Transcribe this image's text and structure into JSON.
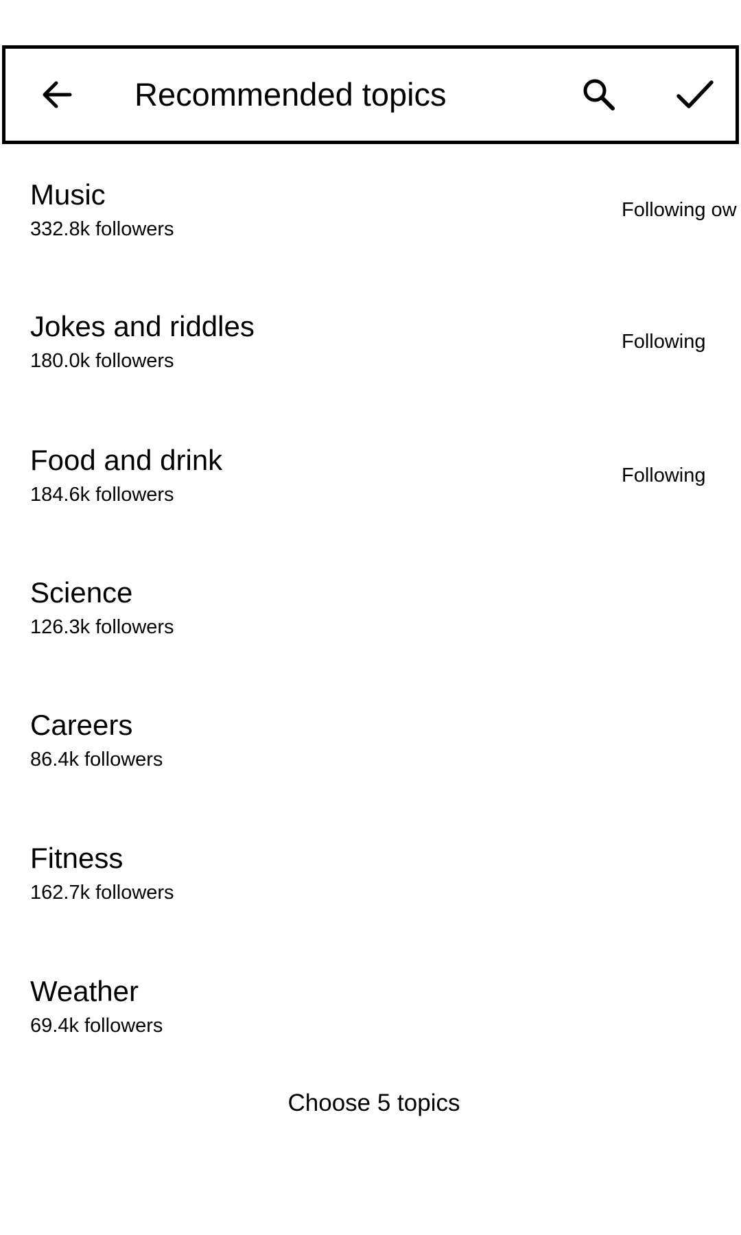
{
  "header": {
    "title": "Recommended topics",
    "back_icon": "arrow-left-icon",
    "search_icon": "search-icon",
    "done_icon": "check-icon"
  },
  "topics": [
    {
      "name": "Music",
      "followers": "332.8k followers",
      "status": "Following ow"
    },
    {
      "name": "Jokes and riddles",
      "followers": "180.0k followers",
      "status": "Following"
    },
    {
      "name": "Food and drink",
      "followers": "184.6k followers",
      "status": "Following"
    },
    {
      "name": "Science",
      "followers": "126.3k followers",
      "status": ""
    },
    {
      "name": "Careers",
      "followers": "86.4k followers",
      "status": ""
    },
    {
      "name": "Fitness",
      "followers": "162.7k followers",
      "status": ""
    },
    {
      "name": "Weather",
      "followers": "69.4k followers",
      "status": ""
    }
  ],
  "footer": {
    "hint": "Choose 5 topics"
  }
}
